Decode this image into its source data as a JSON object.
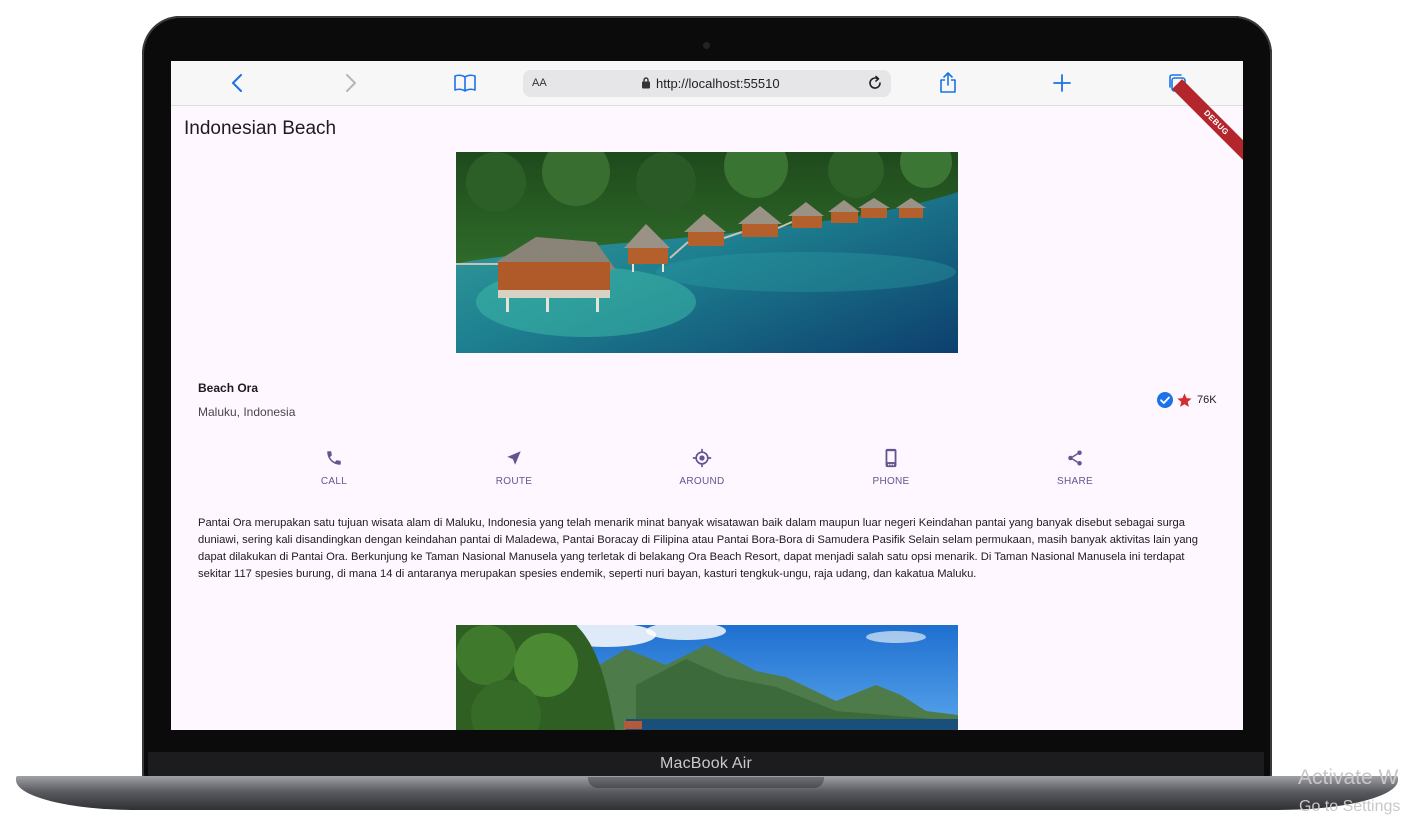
{
  "device": {
    "model_label": "MacBook Air"
  },
  "browser": {
    "text_size_label": "AA",
    "url": "http://localhost:55510"
  },
  "app": {
    "title": "Indonesian Beach",
    "debug_banner": "DEBUG",
    "place": {
      "name": "Beach Ora",
      "location": "Maluku, Indonesia",
      "rating_count": "76K"
    },
    "actions": [
      {
        "label": "CALL",
        "icon": "phone-icon"
      },
      {
        "label": "ROUTE",
        "icon": "navigation-arrow-icon"
      },
      {
        "label": "AROUND",
        "icon": "location-target-icon"
      },
      {
        "label": "PHONE",
        "icon": "smartphone-icon"
      },
      {
        "label": "SHARE",
        "icon": "share-icon"
      }
    ],
    "description": "Pantai Ora merupakan satu tujuan wisata alam di Maluku, Indonesia yang telah menarik minat banyak wisatawan baik dalam maupun luar negeri Keindahan pantai yang banyak disebut sebagai surga duniawi, sering kali disandingkan dengan keindahan pantai di Maladewa, Pantai Boracay di Filipina atau Pantai Bora-Bora di Samudera Pasifik Selain selam permukaan, masih banyak aktivitas lain yang dapat dilakukan di Pantai Ora. Berkunjung ke Taman Nasional Manusela yang terletak di belakang Ora Beach Resort, dapat menjadi salah satu opsi menarik. Di Taman Nasional Manusela ini terdapat sekitar 117 spesies burung, di mana 14 di antaranya merupakan spesies endemik, seperti nuri bayan, kasturi tengkuk-ungu, raja udang, dan kakatua Maluku."
  },
  "os_watermark": {
    "line1": "Activate W",
    "line2": "Go to Settings"
  },
  "colors": {
    "accent": "#65558f",
    "browser_blue": "#1a73e8",
    "star": "#d32f2f",
    "verified": "#1a73e8",
    "debug": "#b3262b"
  }
}
